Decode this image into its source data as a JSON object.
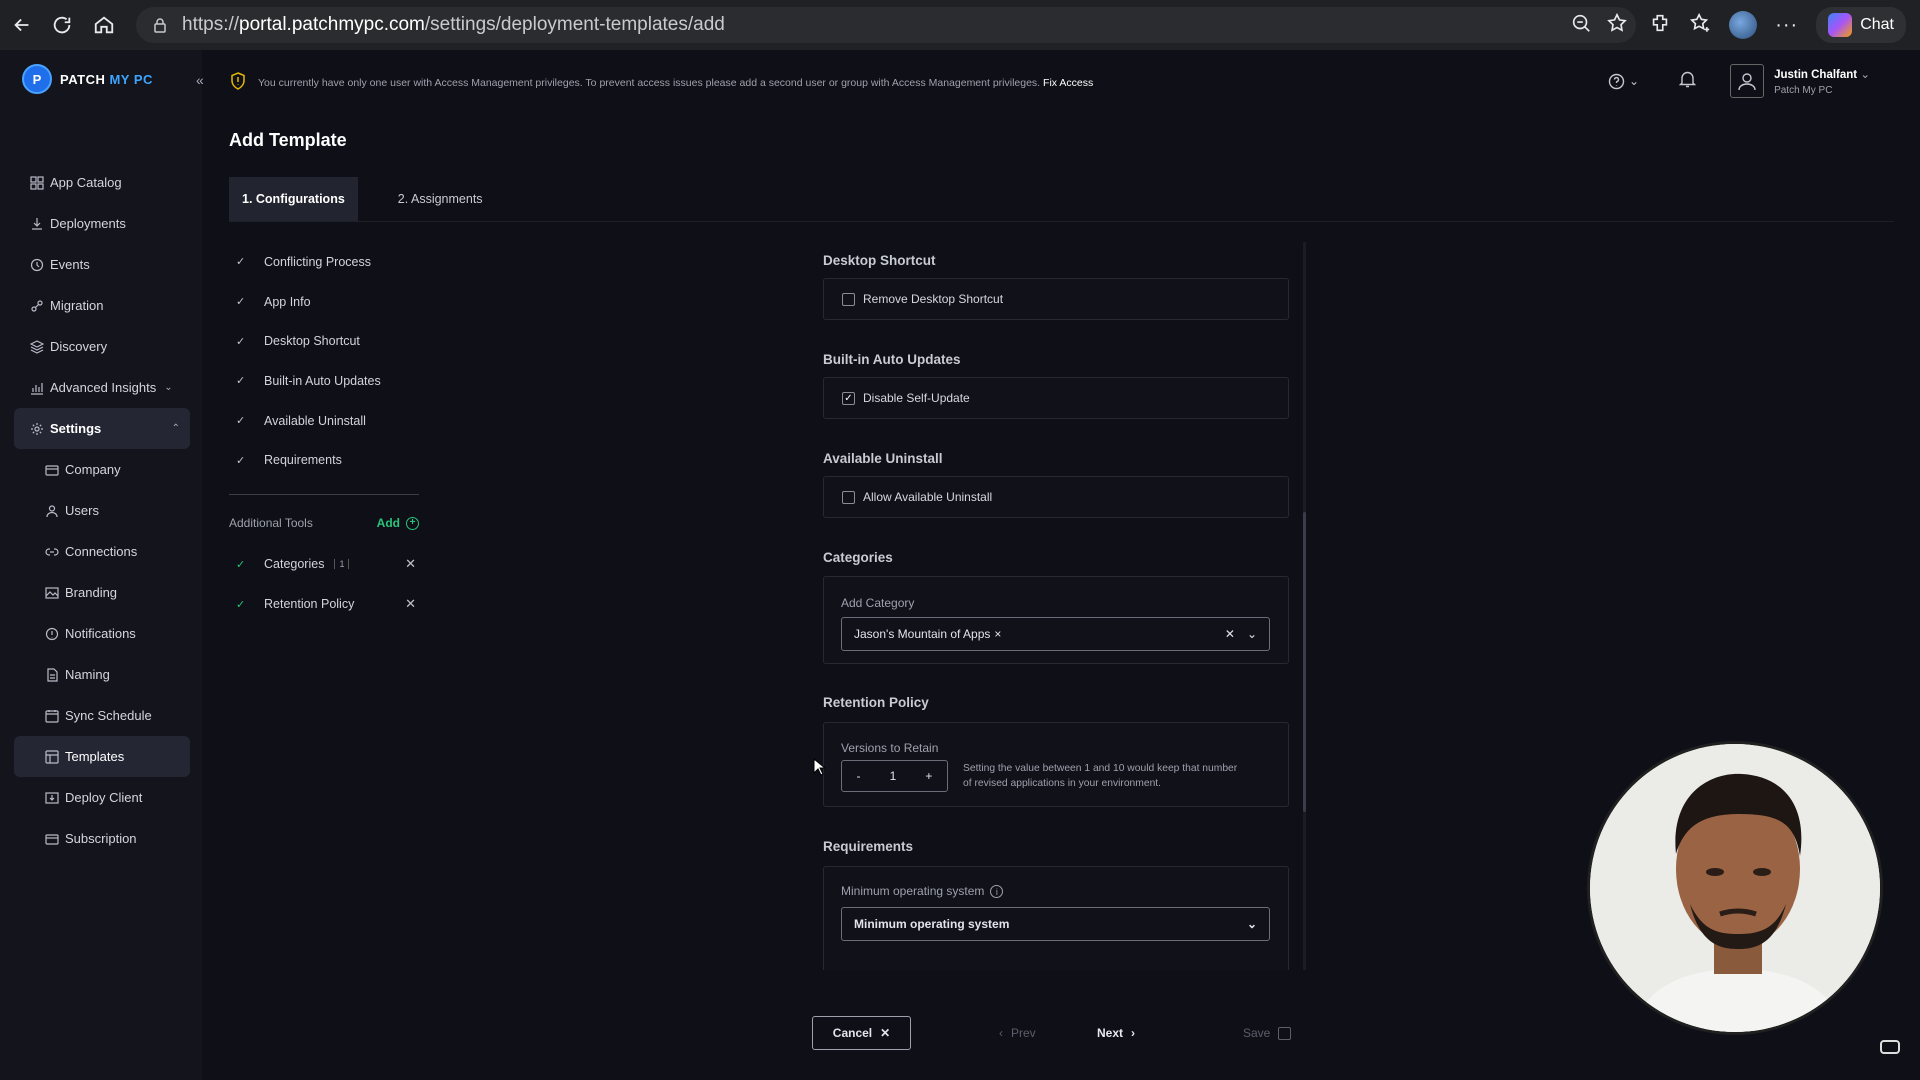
{
  "browser": {
    "url_prefix": "https://",
    "url_host": "portal.patchmypc.com",
    "url_path": "/settings/deployment-templates/add",
    "chat_label": "Chat"
  },
  "brand": {
    "name_part1": "PATCH ",
    "name_part2": "MY PC"
  },
  "sidebar": {
    "items": [
      {
        "label": "App Catalog",
        "icon": "grid-icon"
      },
      {
        "label": "Deployments",
        "icon": "download-icon"
      },
      {
        "label": "Events",
        "icon": "history-icon"
      },
      {
        "label": "Migration",
        "icon": "migration-icon"
      },
      {
        "label": "Discovery",
        "icon": "layers-icon"
      },
      {
        "label": "Advanced Insights",
        "icon": "chart-icon"
      },
      {
        "label": "Settings",
        "icon": "gear-icon"
      },
      {
        "label": "Company",
        "icon": "building-icon"
      },
      {
        "label": "Users",
        "icon": "user-icon"
      },
      {
        "label": "Connections",
        "icon": "link-icon"
      },
      {
        "label": "Branding",
        "icon": "image-icon"
      },
      {
        "label": "Notifications",
        "icon": "bell-icon"
      },
      {
        "label": "Naming",
        "icon": "file-icon"
      },
      {
        "label": "Sync Schedule",
        "icon": "calendar-icon"
      },
      {
        "label": "Templates",
        "icon": "template-icon"
      },
      {
        "label": "Deploy Client",
        "icon": "deploy-icon"
      },
      {
        "label": "Subscription",
        "icon": "card-icon"
      }
    ]
  },
  "banner": {
    "text": "You currently have only one user with Access Management privileges. To prevent access issues please add a second user or group with Access Management privileges.",
    "link": "Fix Access"
  },
  "user": {
    "name": "Justin Chalfant",
    "org": "Patch My PC"
  },
  "page": {
    "title": "Add Template"
  },
  "tabs": [
    "1. Configurations",
    "2. Assignments"
  ],
  "steps": [
    "Conflicting Process",
    "App Info",
    "Desktop Shortcut",
    "Built-in Auto Updates",
    "Available Uninstall",
    "Requirements"
  ],
  "additional_tools": {
    "label": "Additional Tools",
    "add_label": "Add",
    "items": [
      {
        "label": "Categories",
        "badge": "1"
      },
      {
        "label": "Retention Policy"
      }
    ]
  },
  "form": {
    "desktop_shortcut": {
      "title": "Desktop Shortcut",
      "checkbox_label": "Remove Desktop Shortcut",
      "checked": false
    },
    "auto_updates": {
      "title": "Built-in Auto Updates",
      "checkbox_label": "Disable Self-Update",
      "checked": true
    },
    "available_uninstall": {
      "title": "Available Uninstall",
      "checkbox_label": "Allow Available Uninstall",
      "checked": false
    },
    "categories": {
      "title": "Categories",
      "field_label": "Add Category",
      "selected_tag": "Jason's Mountain of Apps"
    },
    "retention": {
      "title": "Retention Policy",
      "field_label": "Versions to Retain",
      "value": "1",
      "help_line1": "Setting the value between 1 and 10 would keep that number",
      "help_line2": "of revised applications in your environment."
    },
    "requirements": {
      "title": "Requirements",
      "field_label": "Minimum operating system",
      "selected": "Minimum operating system"
    }
  },
  "footer": {
    "cancel": "Cancel",
    "prev": "Prev",
    "next": "Next",
    "save": "Save"
  }
}
